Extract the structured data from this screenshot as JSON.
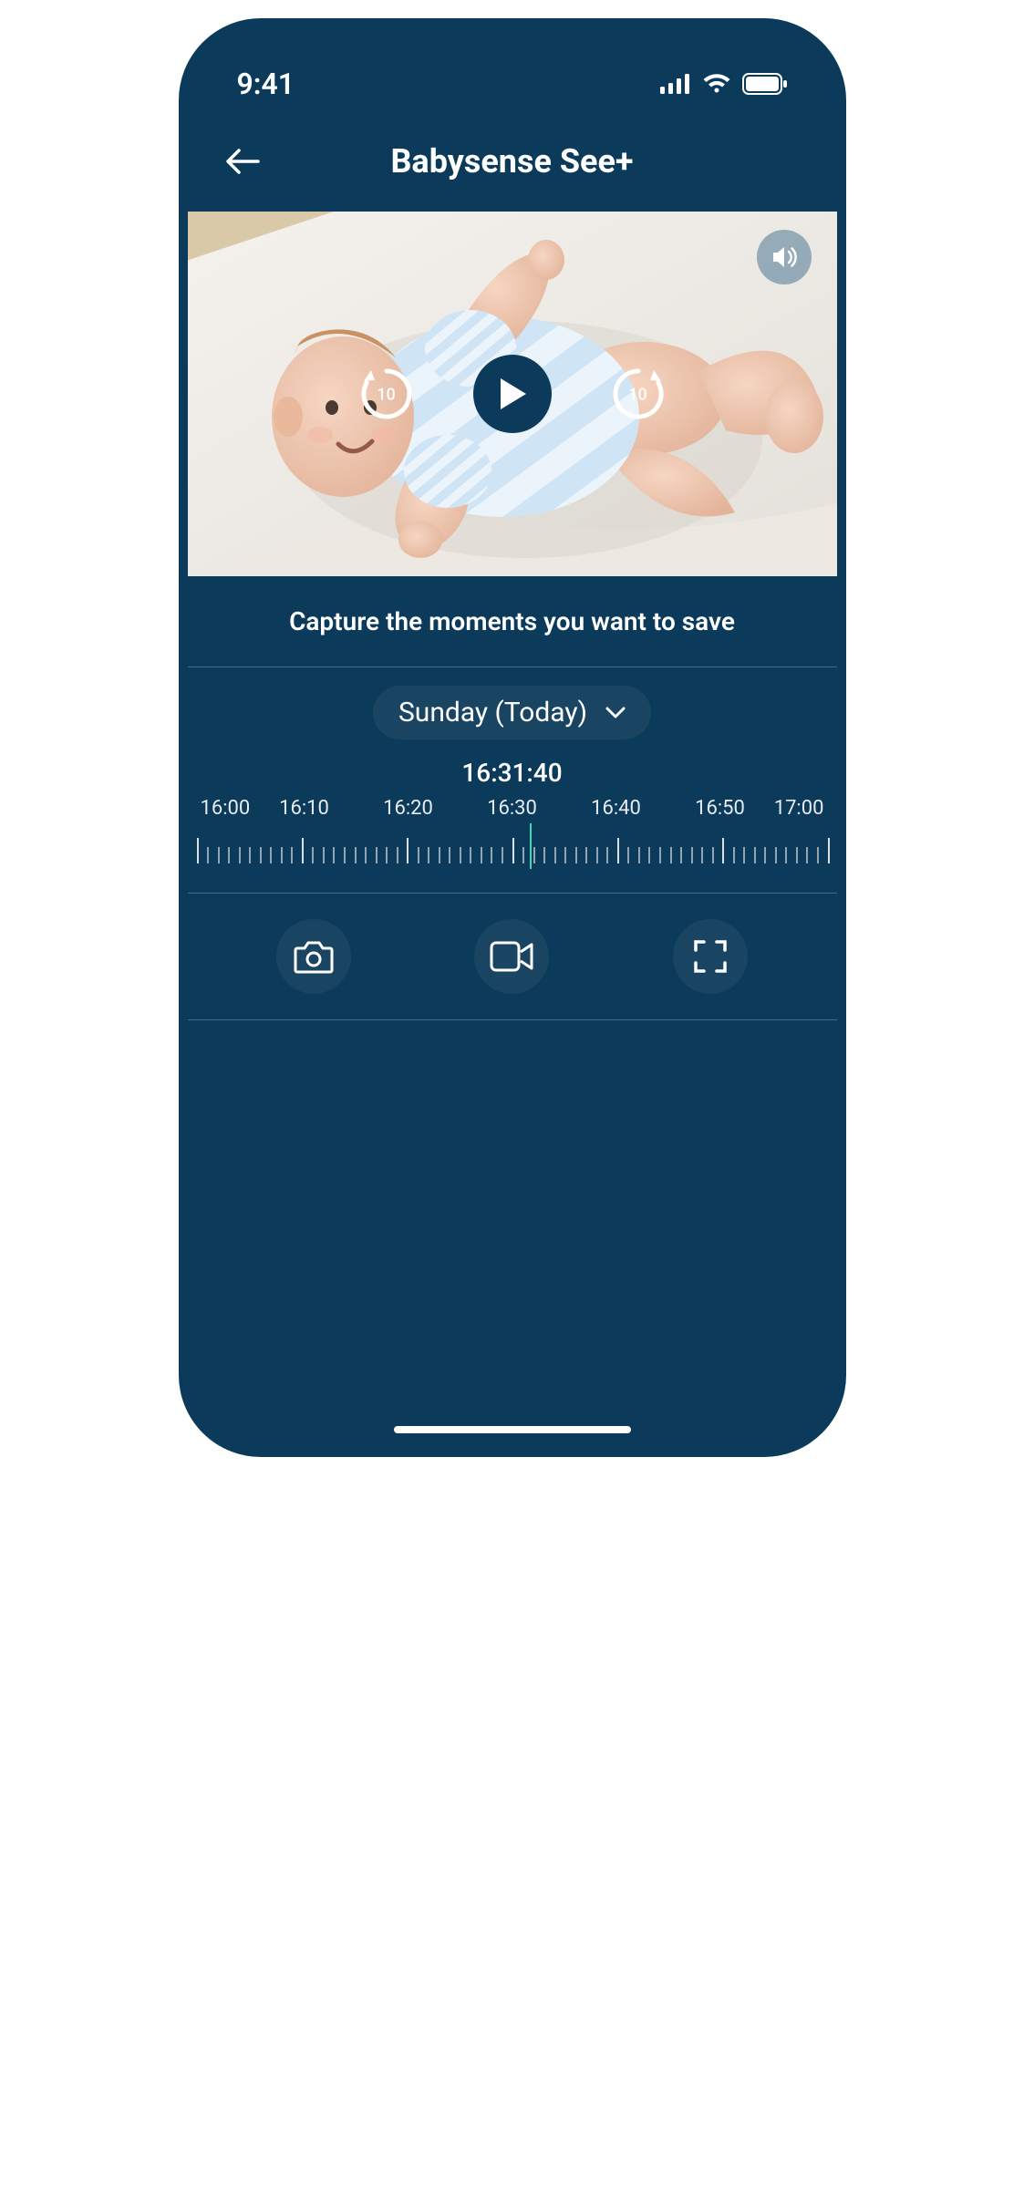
{
  "status": {
    "time": "9:41"
  },
  "header": {
    "title": "Babysense See+"
  },
  "video": {
    "skip_back": "10",
    "skip_forward": "10"
  },
  "caption": "Capture the moments you want to save",
  "day_selector": {
    "label": "Sunday (Today)"
  },
  "timeline": {
    "current": "16:31:40",
    "labels": [
      "16:00",
      "16:10",
      "16:20",
      "16:30",
      "16:40",
      "16:50",
      "17:00"
    ],
    "cursor_percent": 52.8
  }
}
